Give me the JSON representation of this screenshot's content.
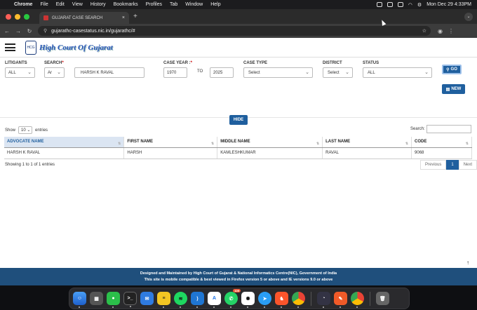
{
  "menubar": {
    "apple": "",
    "app": "Chrome",
    "items": [
      "File",
      "Edit",
      "View",
      "History",
      "Bookmarks",
      "Profiles",
      "Tab",
      "Window",
      "Help"
    ],
    "clock": "Mon Dec 29  4:33PM"
  },
  "browser": {
    "tab_title": "GUJARAT CASE SEARCH",
    "url": "gujarathc-casestatus.nic.in/gujarathc/#",
    "tab_close": "×",
    "new_tab": "+"
  },
  "site": {
    "logo_text": "High Court Of Gujarat",
    "emblem_text": "HCG"
  },
  "form": {
    "litigants_label": "LITIGANTS",
    "litigants_value": "ALL",
    "search_label": "SEARCH",
    "search_req": "*",
    "search_type_value": "Ar",
    "search_value": "HARSH K RAVAL",
    "caseyear_label": "CASE YEAR :",
    "caseyear_req": "*",
    "year_from": "1970",
    "to_label": "TO",
    "year_to": "2025",
    "casetype_label": "CASE TYPE",
    "casetype_value": "Select",
    "district_label": "DISTRICT",
    "district_value": "Select",
    "status_label": "STATUS",
    "status_value": "ALL",
    "go_label": "GO",
    "new_label": "NEW",
    "hide_label": "HIDE"
  },
  "table": {
    "show_label": "Show",
    "show_value": "10",
    "entries_label": "entries",
    "search_label": "Search:",
    "headers": [
      "ADVOCATE NAME",
      "FIRST NAME",
      "MIDDLE NAME",
      "LAST NAME",
      "CODE"
    ],
    "rows": [
      [
        "HARSH K RAVAL",
        "HARSH",
        "KAMLESHKUMAR",
        "RAVAL",
        "9068"
      ]
    ],
    "info": "Showing 1 to 1 of 1 entries",
    "prev": "Previous",
    "page": "1",
    "next": "Next"
  },
  "footer": {
    "line1": "Designed and Maintained by High Court of Gujarat & National Informatics Centre(NIC), Government of India",
    "line2": "This site is mobile compatible & best viewed in Firefox version 5 or above and IE versions 9.0 or above"
  },
  "dock": {
    "whatsapp_badge": "109"
  },
  "colors": {
    "primary": "#1f5f9e",
    "footer": "#1f4f7c"
  }
}
